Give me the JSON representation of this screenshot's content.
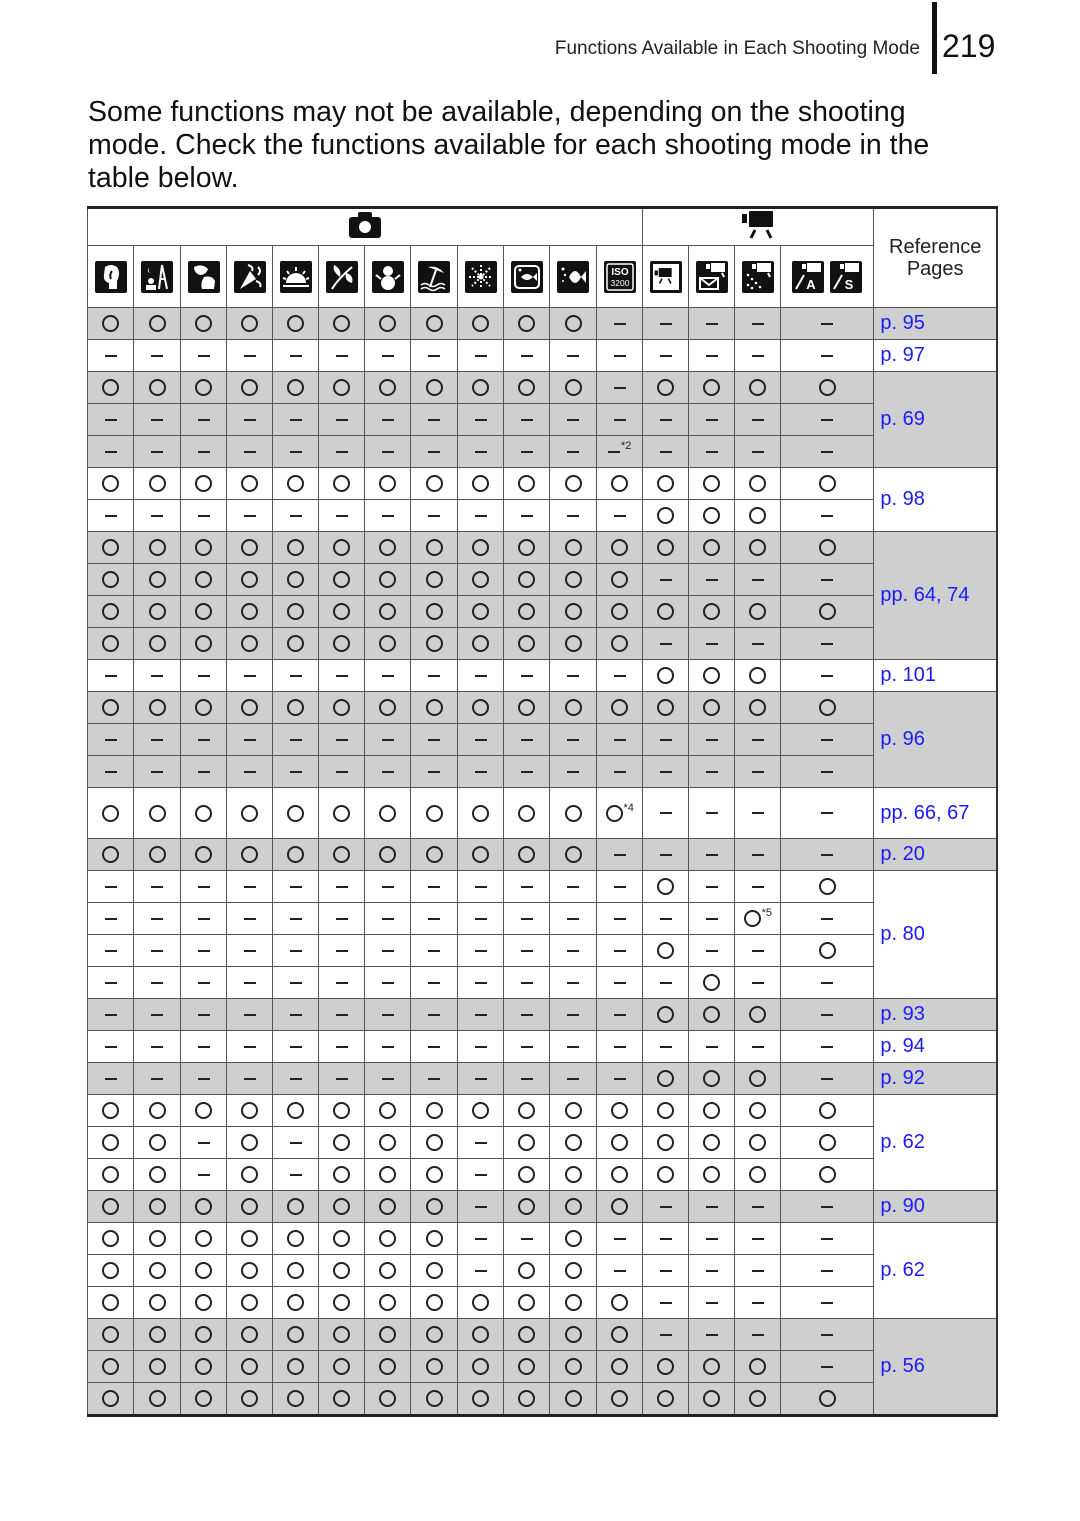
{
  "header": {
    "running_title": "Functions Available in Each Shooting Mode",
    "page_number": "219"
  },
  "intro": "Some functions may not be available, depending on the shooting mode. Check the functions available for each shooting mode in the table below.",
  "table": {
    "group_headers": [
      {
        "icon": "still-camera-icon",
        "span": 12
      },
      {
        "icon": "movie-camera-icon",
        "span": 4
      }
    ],
    "reference_header": [
      "Reference",
      "Pages"
    ],
    "mode_icons": [
      "portrait-icon",
      "night-snapshot-icon",
      "kids-pets-icon",
      "indoor-party-icon",
      "sunset-icon",
      "foliage-icon",
      "snow-icon",
      "beach-icon",
      "fireworks-icon",
      "aquarium-icon",
      "underwater-icon",
      "iso-3200-icon",
      "movie-standard-icon",
      "movie-compact-icon",
      "movie-color-accent-icon",
      "movie-color-swap-icon"
    ],
    "iso_label": [
      "ISO",
      "3200"
    ],
    "legend": {
      "o": "available",
      "-": "not available"
    },
    "groups": [
      {
        "ref": "p. 95",
        "shade": "gray",
        "rows": [
          [
            "o",
            "o",
            "o",
            "o",
            "o",
            "o",
            "o",
            "o",
            "o",
            "o",
            "o",
            "-",
            "-",
            "-",
            "-",
            "-"
          ]
        ]
      },
      {
        "ref": "p. 97",
        "shade": "white",
        "rows": [
          [
            "-",
            "-",
            "-",
            "-",
            "-",
            "-",
            "-",
            "-",
            "-",
            "-",
            "-",
            "-",
            "-",
            "-",
            "-",
            "-"
          ]
        ]
      },
      {
        "ref": "p. 69",
        "shade": "gray",
        "rows": [
          [
            "o",
            "o",
            "o",
            "o",
            "o",
            "o",
            "o",
            "o",
            "o",
            "o",
            "o",
            "-",
            "o",
            "o",
            "o",
            "o"
          ],
          [
            "-",
            "-",
            "-",
            "-",
            "-",
            "-",
            "-",
            "-",
            "-",
            "-",
            "-",
            "-",
            "-",
            "-",
            "-",
            "-"
          ],
          [
            "-",
            "-",
            "-",
            "-",
            "-",
            "-",
            "-",
            "-",
            "-",
            "-",
            "-",
            "-*2",
            "-",
            "-",
            "-",
            "-"
          ]
        ]
      },
      {
        "ref": "p. 98",
        "shade": "white",
        "rows": [
          [
            "o",
            "o",
            "o",
            "o",
            "o",
            "o",
            "o",
            "o",
            "o",
            "o",
            "o",
            "o",
            "o",
            "o",
            "o",
            "o"
          ],
          [
            "-",
            "-",
            "-",
            "-",
            "-",
            "-",
            "-",
            "-",
            "-",
            "-",
            "-",
            "-",
            "o",
            "o",
            "o",
            "-"
          ]
        ]
      },
      {
        "ref": "pp. 64, 74",
        "shade": "gray",
        "rows": [
          [
            "o",
            "o",
            "o",
            "o",
            "o",
            "o",
            "o",
            "o",
            "o",
            "o",
            "o",
            "o",
            "o",
            "o",
            "o",
            "o"
          ],
          [
            "o",
            "o",
            "o",
            "o",
            "o",
            "o",
            "o",
            "o",
            "o",
            "o",
            "o",
            "o",
            "-",
            "-",
            "-",
            "-"
          ],
          [
            "o",
            "o",
            "o",
            "o",
            "o",
            "o",
            "o",
            "o",
            "o",
            "o",
            "o",
            "o",
            "o",
            "o",
            "o",
            "o"
          ],
          [
            "o",
            "o",
            "o",
            "o",
            "o",
            "o",
            "o",
            "o",
            "o",
            "o",
            "o",
            "o",
            "-",
            "-",
            "-",
            "-"
          ]
        ]
      },
      {
        "ref": "p. 101",
        "shade": "white",
        "rows": [
          [
            "-",
            "-",
            "-",
            "-",
            "-",
            "-",
            "-",
            "-",
            "-",
            "-",
            "-",
            "-",
            "o",
            "o",
            "o",
            "-"
          ]
        ]
      },
      {
        "ref": "p. 96",
        "shade": "gray",
        "rows": [
          [
            "o",
            "o",
            "o",
            "o",
            "o",
            "o",
            "o",
            "o",
            "o",
            "o",
            "o",
            "o",
            "o",
            "o",
            "o",
            "o"
          ],
          [
            "-",
            "-",
            "-",
            "-",
            "-",
            "-",
            "-",
            "-",
            "-",
            "-",
            "-",
            "-",
            "-",
            "-",
            "-",
            "-"
          ],
          [
            "-",
            "-",
            "-",
            "-",
            "-",
            "-",
            "-",
            "-",
            "-",
            "-",
            "-",
            "-",
            "-",
            "-",
            "-",
            "-"
          ]
        ]
      },
      {
        "ref": "pp. 66, 67",
        "shade": "white",
        "tall": true,
        "rows": [
          [
            "o",
            "o",
            "o",
            "o",
            "o",
            "o",
            "o",
            "o",
            "o",
            "o",
            "o",
            "o*4",
            "-",
            "-",
            "-",
            "-"
          ]
        ]
      },
      {
        "ref": "p. 20",
        "shade": "gray",
        "rows": [
          [
            "o",
            "o",
            "o",
            "o",
            "o",
            "o",
            "o",
            "o",
            "o",
            "o",
            "o",
            "-",
            "-",
            "-",
            "-",
            "-"
          ]
        ]
      },
      {
        "ref": "p. 80",
        "shade": "white",
        "rows": [
          [
            "-",
            "-",
            "-",
            "-",
            "-",
            "-",
            "-",
            "-",
            "-",
            "-",
            "-",
            "-",
            "o",
            "-",
            "-",
            "o"
          ],
          [
            "-",
            "-",
            "-",
            "-",
            "-",
            "-",
            "-",
            "-",
            "-",
            "-",
            "-",
            "-",
            "-",
            "-",
            "o*5",
            "-"
          ],
          [
            "-",
            "-",
            "-",
            "-",
            "-",
            "-",
            "-",
            "-",
            "-",
            "-",
            "-",
            "-",
            "o",
            "-",
            "-",
            "o"
          ],
          [
            "-",
            "-",
            "-",
            "-",
            "-",
            "-",
            "-",
            "-",
            "-",
            "-",
            "-",
            "-",
            "-",
            "o",
            "-",
            "-"
          ]
        ]
      },
      {
        "ref": "p. 93",
        "shade": "gray",
        "rows": [
          [
            "-",
            "-",
            "-",
            "-",
            "-",
            "-",
            "-",
            "-",
            "-",
            "-",
            "-",
            "-",
            "o",
            "o",
            "o",
            "-"
          ]
        ]
      },
      {
        "ref": "p. 94",
        "shade": "white",
        "rows": [
          [
            "-",
            "-",
            "-",
            "-",
            "-",
            "-",
            "-",
            "-",
            "-",
            "-",
            "-",
            "-",
            "-",
            "-",
            "-",
            "-"
          ]
        ]
      },
      {
        "ref": "p. 92",
        "shade": "gray",
        "rows": [
          [
            "-",
            "-",
            "-",
            "-",
            "-",
            "-",
            "-",
            "-",
            "-",
            "-",
            "-",
            "-",
            "o",
            "o",
            "o",
            "-"
          ]
        ]
      },
      {
        "ref": "p. 62",
        "shade": "white",
        "rows": [
          [
            "o",
            "o",
            "o",
            "o",
            "o",
            "o",
            "o",
            "o",
            "o",
            "o",
            "o",
            "o",
            "o",
            "o",
            "o",
            "o"
          ],
          [
            "o",
            "o",
            "-",
            "o",
            "-",
            "o",
            "o",
            "o",
            "-",
            "o",
            "o",
            "o",
            "o",
            "o",
            "o",
            "o"
          ],
          [
            "o",
            "o",
            "-",
            "o",
            "-",
            "o",
            "o",
            "o",
            "-",
            "o",
            "o",
            "o",
            "o",
            "o",
            "o",
            "o"
          ]
        ]
      },
      {
        "ref": "p. 90",
        "shade": "gray",
        "rows": [
          [
            "o",
            "o",
            "o",
            "o",
            "o",
            "o",
            "o",
            "o",
            "-",
            "o",
            "o",
            "o",
            "-",
            "-",
            "-",
            "-"
          ]
        ]
      },
      {
        "ref": "p. 62",
        "shade": "white",
        "rows": [
          [
            "o",
            "o",
            "o",
            "o",
            "o",
            "o",
            "o",
            "o",
            "-",
            "-",
            "o",
            "-",
            "-",
            "-",
            "-",
            "-"
          ],
          [
            "o",
            "o",
            "o",
            "o",
            "o",
            "o",
            "o",
            "o",
            "-",
            "o",
            "o",
            "-",
            "-",
            "-",
            "-",
            "-"
          ],
          [
            "o",
            "o",
            "o",
            "o",
            "o",
            "o",
            "o",
            "o",
            "o",
            "o",
            "o",
            "o",
            "-",
            "-",
            "-",
            "-"
          ]
        ]
      },
      {
        "ref": "p. 56",
        "shade": "gray",
        "rows": [
          [
            "o",
            "o",
            "o",
            "o",
            "o",
            "o",
            "o",
            "o",
            "o",
            "o",
            "o",
            "o",
            "-",
            "-",
            "-",
            "-"
          ],
          [
            "o",
            "o",
            "o",
            "o",
            "o",
            "o",
            "o",
            "o",
            "o",
            "o",
            "o",
            "o",
            "o",
            "o",
            "o",
            "-"
          ],
          [
            "o",
            "o",
            "o",
            "o",
            "o",
            "o",
            "o",
            "o",
            "o",
            "o",
            "o",
            "o",
            "o",
            "o",
            "o",
            "o"
          ]
        ]
      }
    ]
  }
}
